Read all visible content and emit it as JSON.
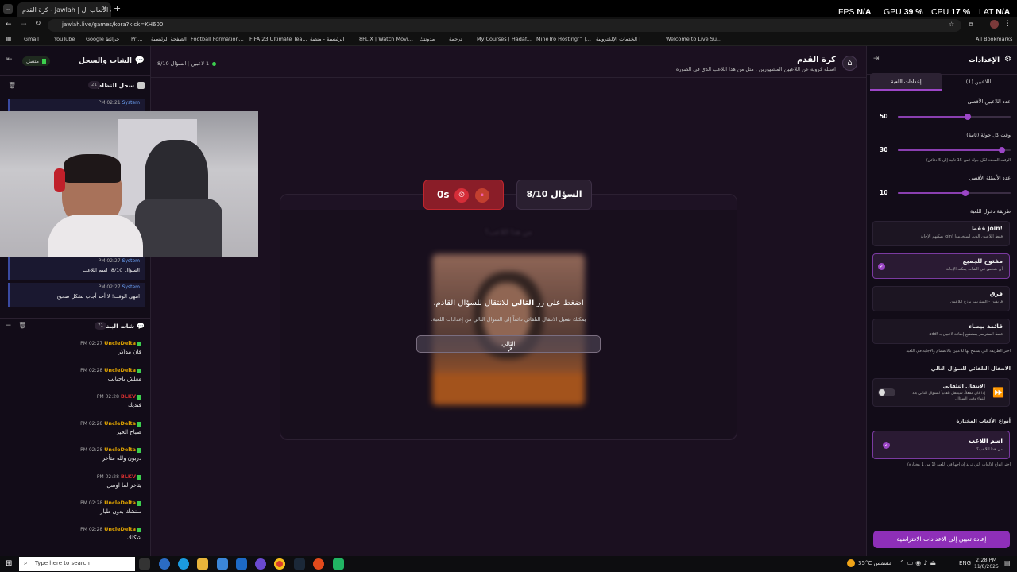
{
  "browser": {
    "tab_title": "كرة القدم - Jawlah | جولة - منصة الألعاب ال",
    "url": "jawlah.live/games/kora?kick=KH600",
    "bookmarks": [
      "Gmail",
      "YouTube",
      "Google خرائط",
      "Pri...",
      "الصفحة الرئيسية",
      "Football Formation...",
      "FIFA 23 Ultimate Tea...",
      "الرئيسية - منصة",
      "8FLIX | Watch Movi...",
      "مدونتك",
      "ترجمة",
      "My Courses | Hadaf...",
      "MineTro Hosting™ |...",
      "الخدمات الإلكترونية |",
      "Welcome to Live Su..."
    ],
    "all_bookmarks": "All Bookmarks"
  },
  "overlay": {
    "fps_label": "FPS",
    "fps_value": "N/A",
    "gpu_label": "GPU",
    "gpu_value": "39 %",
    "cpu_label": "CPU",
    "cpu_value": "17 %",
    "lat_label": "LAT",
    "lat_value": "N/A"
  },
  "left": {
    "header_title": "الشات والسجل",
    "connected": "متصل",
    "system_log_title": "سجل النظام",
    "system_log_count": "21",
    "log_entries": [
      {
        "time": "PM 02:21",
        "user": "System",
        "text": ""
      },
      {
        "time": "PM 02:27",
        "user": "System",
        "text": "السؤال 8/10: اسم اللاعب"
      },
      {
        "time": "PM 02:27",
        "user": "System",
        "text": "انتهى الوقت! لا أحد أجاب بشكل صحيح"
      }
    ],
    "live_chat_title": "شات البث",
    "live_chat_count": "71",
    "chat": [
      {
        "time": "PM 02:27",
        "user": "UncleDelta",
        "color": "#e0a400",
        "text": "فان مداكر"
      },
      {
        "time": "PM 02:28",
        "user": "UncleDelta",
        "color": "#e0a400",
        "text": "معلش باحبايب"
      },
      {
        "time": "PM 02:28",
        "user": "BLKV",
        "color": "#d83030",
        "text": "فنديك"
      },
      {
        "time": "PM 02:28",
        "user": "UncleDelta",
        "color": "#e0a400",
        "text": "صباح الخير"
      },
      {
        "time": "PM 02:28",
        "user": "UncleDelta",
        "color": "#e0a400",
        "text": "دربون ولله متأخر"
      },
      {
        "time": "PM 02:28",
        "user": "BLKV",
        "color": "#d83030",
        "text": "يتاخر لما اوسل"
      },
      {
        "time": "PM 02:28",
        "user": "UncleDelta",
        "color": "#e0a400",
        "text": "سنشك بدون طيار"
      },
      {
        "time": "PM 02:28",
        "user": "UncleDelta",
        "color": "#e0a400",
        "text": "شكلك"
      }
    ]
  },
  "center": {
    "game_title": "كرة القدم",
    "game_subtitle": "اسئلة كروية عن اللاعبين المشهورين , مثل من هذا اللاعب الذي في الصورة",
    "players_online": "1 لاعبين",
    "question_counter_small": "السؤال 8/10",
    "question_badge": "السؤال 8/10",
    "timer": "0s",
    "blurred_heading": "من هذا اللاعب؟",
    "prompt_prefix": "اضغط على زر",
    "prompt_bold": "التالي",
    "prompt_suffix": "للانتقال للسؤال القادم.",
    "hint": "يمكنك تفعيل الانتقال التلقائي دائماً إلى السؤال التالي من إعدادات اللعبة.",
    "next_button": "التالي"
  },
  "right": {
    "header_title": "الإعدادات",
    "tab_players": "اللاعبين (1)",
    "tab_settings": "إعدادات اللعبة",
    "max_players_label": "عدد اللاعبين الأقصى",
    "max_players_value": 50,
    "max_players_fraction": 0.62,
    "round_time_label": "وقت كل جولة (ثانية)",
    "round_time_value": 30,
    "round_time_fraction": 0.92,
    "round_time_hint": "الوقت المحدد لكل جولة (من 15 ثانية إلى 5 دقائق)",
    "max_questions_label": "عدد الأسئلة الأقصى",
    "max_questions_value": 10,
    "max_questions_fraction": 0.6,
    "entry_method_label": "طريقة دخول اللعبة",
    "modes": [
      {
        "title": "!join فقط",
        "desc": "فقط اللاعبين الذين استخدموا !join يمكنهم الإجابة",
        "selected": false
      },
      {
        "title": "مفتوح للجميع",
        "desc": "أي شخص في الشات يمكنه الإجابة",
        "selected": true
      },
      {
        "title": "فرق",
        "desc": "فريقين - الستريمر يوزع اللاعبين",
        "selected": false
      },
      {
        "title": "قائمة بيضاء",
        "desc": "فقط الستريمر يستطيع إضافة لاعبين بـ !add",
        "selected": false
      }
    ],
    "entry_hint": "اختر الطريقة التي يسمح بها للاعبين بالانضمام والإجابة في اللعبة",
    "auto_next_label": "الانتقال التلقائي للسؤال التالي",
    "auto_next_title": "الانتقال التلقائي",
    "auto_next_desc": "إذا كان مفعلاً، سينتقل تلقائياً للسؤال التالي بعد انتهاء وقت السؤال.",
    "auto_next_enabled": false,
    "game_types_label": "أنواع الألعاب المختارة",
    "game_type_title": "اسم اللاعب",
    "game_type_desc": "من هذا اللاعب؟",
    "game_types_hint": "اختر أنواع الألعاب التي تريد إدراجها في اللعبة (1 من 1 مختارة)",
    "reset_button": "إعادة تعيين إلى الاعدادات الافتراضية"
  },
  "taskbar": {
    "search_placeholder": "Type here to search",
    "weather": "35°C  مشمس",
    "lang": "ENG",
    "time": "2:28 PM",
    "date": "11/8/2025"
  },
  "colors": {
    "accent": "#9c46c7",
    "timer_red": "#c0262e",
    "online_green": "#3ccf4e"
  }
}
